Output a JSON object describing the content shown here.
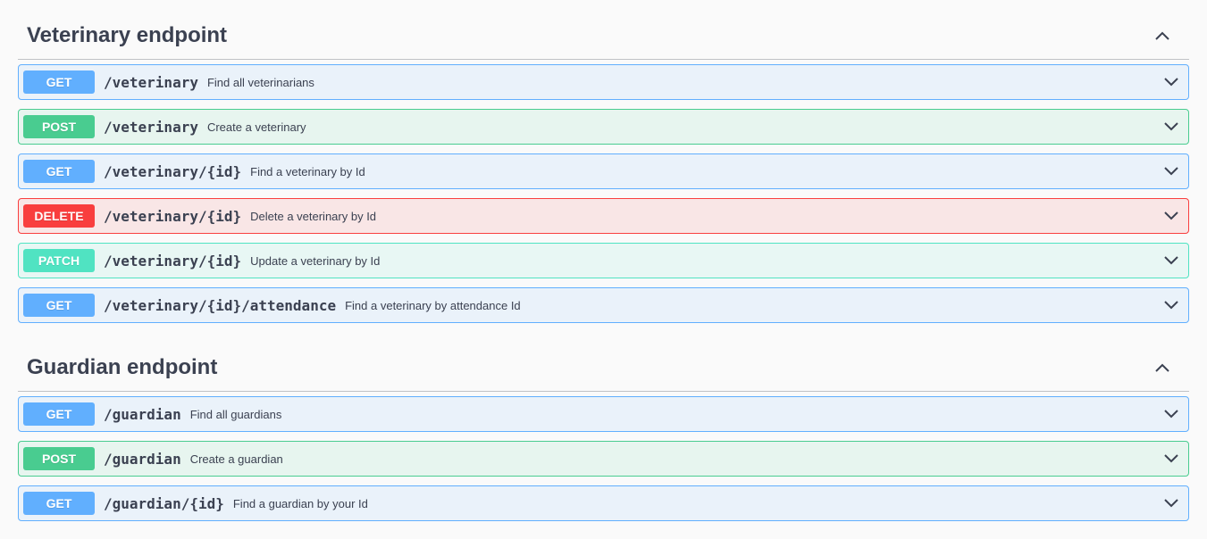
{
  "sections": [
    {
      "title": "Veterinary endpoint",
      "operations": [
        {
          "method": "GET",
          "path": "/veterinary",
          "summary": "Find all veterinarians"
        },
        {
          "method": "POST",
          "path": "/veterinary",
          "summary": "Create a veterinary"
        },
        {
          "method": "GET",
          "path": "/veterinary/{id}",
          "summary": "Find a veterinary by Id"
        },
        {
          "method": "DELETE",
          "path": "/veterinary/{id}",
          "summary": "Delete a veterinary by Id"
        },
        {
          "method": "PATCH",
          "path": "/veterinary/{id}",
          "summary": "Update a veterinary by Id"
        },
        {
          "method": "GET",
          "path": "/veterinary/{id}/attendance",
          "summary": "Find a veterinary by attendance Id"
        }
      ]
    },
    {
      "title": "Guardian endpoint",
      "operations": [
        {
          "method": "GET",
          "path": "/guardian",
          "summary": "Find all guardians"
        },
        {
          "method": "POST",
          "path": "/guardian",
          "summary": "Create a guardian"
        },
        {
          "method": "GET",
          "path": "/guardian/{id}",
          "summary": "Find a guardian by your Id"
        }
      ]
    }
  ],
  "colors": {
    "get": "#61affe",
    "post": "#49cc90",
    "delete": "#f93e3e",
    "patch": "#50e3c2"
  },
  "icons": {
    "collapse": "chevron-up-icon",
    "expand": "chevron-down-icon"
  }
}
